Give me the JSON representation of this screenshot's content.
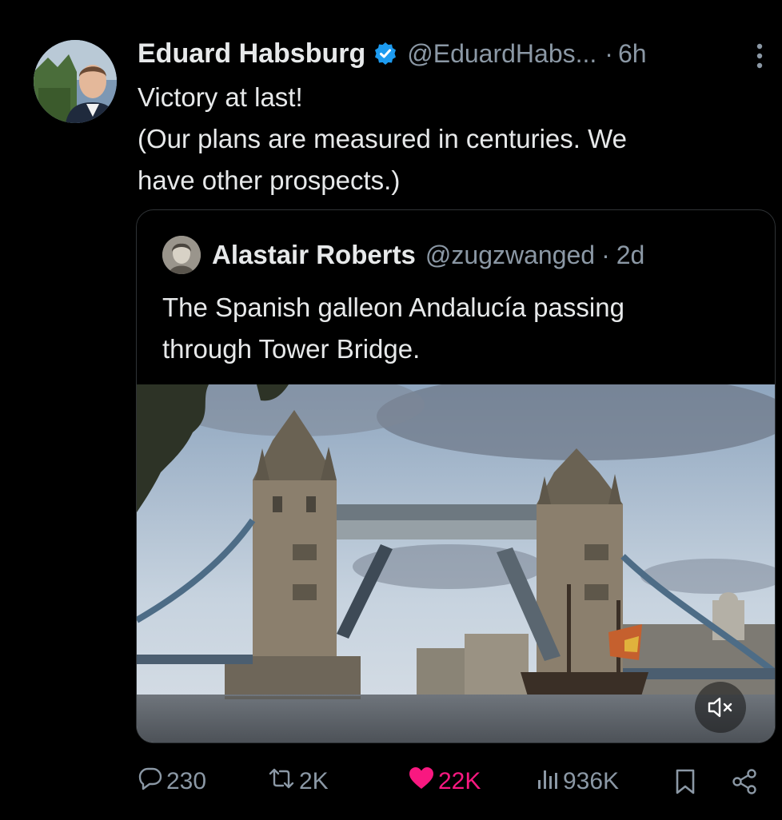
{
  "author": {
    "name": "Eduard Habsburg",
    "handle": "@EduardHabs...",
    "separator": "·",
    "time": "6h"
  },
  "tweet": {
    "lines": [
      "Victory at last!",
      "(Our plans are measured in centuries. We",
      "have other prospects.)"
    ]
  },
  "quoted": {
    "name": "Alastair Roberts",
    "handle": "@zugzwanged",
    "separator": "·",
    "time": "2d",
    "lines": [
      "The Spanish galleon Andalucía passing",
      "through Tower Bridge."
    ]
  },
  "actions": {
    "replies": "230",
    "reposts": "2K",
    "likes": "22K",
    "views": "936K"
  },
  "colors": {
    "background": "#000000",
    "text": "#e7e9ea",
    "muted": "#8b98a5",
    "verified": "#1d9bf0",
    "like": "#f91880",
    "border": "#2f3336"
  },
  "icons": [
    "verified-badge-icon",
    "more-icon",
    "speaker-muted-icon",
    "reply-icon",
    "repost-icon",
    "heart-icon",
    "views-icon",
    "bookmark-icon",
    "share-icon"
  ]
}
